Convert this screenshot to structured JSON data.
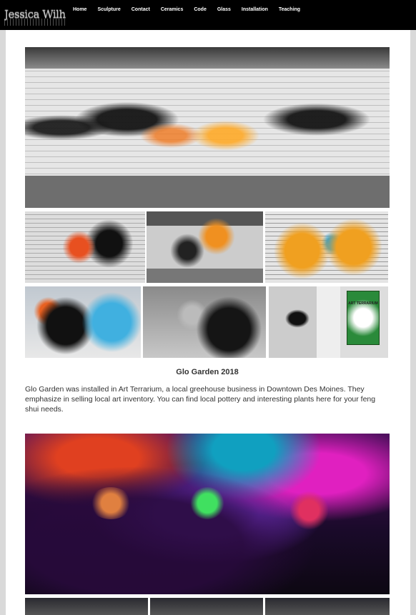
{
  "logo": {
    "text": "Jessica Wilhite"
  },
  "nav": {
    "items": [
      "Home",
      "Sculpture",
      "Contact",
      "Ceramics",
      "Code",
      "Glass",
      "Installation",
      "Teaching"
    ]
  },
  "gallery1": {
    "sign_text": "ART TERRARIUM"
  },
  "project": {
    "title": "Glo Garden 2018",
    "description": "Glo Garden was installed in Art Terrarium, a local greehouse business in Downtown Des Moines. They emphasize in selling local art inventory. You can find local pottery and interesting plants here for your feng shui needs."
  }
}
